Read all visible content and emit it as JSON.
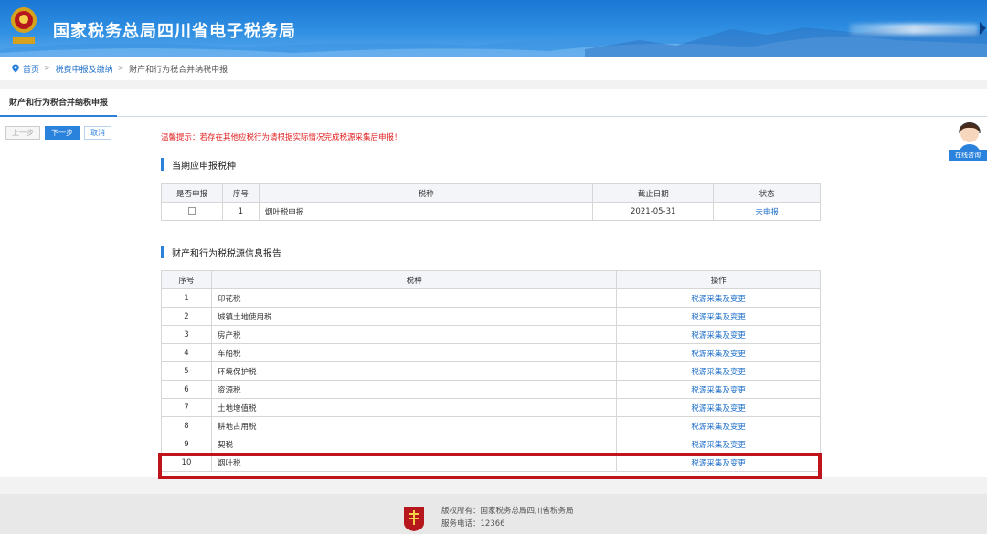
{
  "header": {
    "title": "国家税务总局四川省电子税务局",
    "user_masked": "████████"
  },
  "breadcrumb": {
    "home": "首页",
    "level1": "税费申报及缴纳",
    "current": "财产和行为税合并纳税申报"
  },
  "tab": {
    "label": "财产和行为税合并纳税申报"
  },
  "buttons": {
    "prev": "上一步",
    "next": "下一步",
    "cancel": "取消"
  },
  "section1": {
    "title": "当期应申报税种",
    "headers": [
      "是否申报",
      "序号",
      "税种",
      "截止日期",
      "状态"
    ],
    "row": {
      "seq": "1",
      "tax": "烟叶税申报",
      "deadline": "2021-05-31",
      "status": "未申报"
    },
    "tip": "温馨提示：若存在其他应税行为请根据实际情况完成税源采集后申报！"
  },
  "section2": {
    "title": "财产和行为税税源信息报告",
    "headers": [
      "序号",
      "税种",
      "操作"
    ],
    "rows": [
      {
        "seq": "1",
        "tax": "印花税",
        "action": "税源采集及变更"
      },
      {
        "seq": "2",
        "tax": "城镇土地使用税",
        "action": "税源采集及变更"
      },
      {
        "seq": "3",
        "tax": "房产税",
        "action": "税源采集及变更"
      },
      {
        "seq": "4",
        "tax": "车船税",
        "action": "税源采集及变更"
      },
      {
        "seq": "5",
        "tax": "环境保护税",
        "action": "税源采集及变更"
      },
      {
        "seq": "6",
        "tax": "资源税",
        "action": "税源采集及变更"
      },
      {
        "seq": "7",
        "tax": "土地增值税",
        "action": "税源采集及变更"
      },
      {
        "seq": "8",
        "tax": "耕地占用税",
        "action": "税源采集及变更"
      },
      {
        "seq": "9",
        "tax": "契税",
        "action": "税源采集及变更"
      },
      {
        "seq": "10",
        "tax": "烟叶税",
        "action": "税源采集及变更"
      }
    ]
  },
  "consult": {
    "label": "在线咨询"
  },
  "footer": {
    "copyright": "版权所有：国家税务总局四川省税务局",
    "phone": "服务电话：12366"
  },
  "colors": {
    "primary": "#2b82dc",
    "highlight": "#c0141c",
    "warning": "#e02020"
  }
}
